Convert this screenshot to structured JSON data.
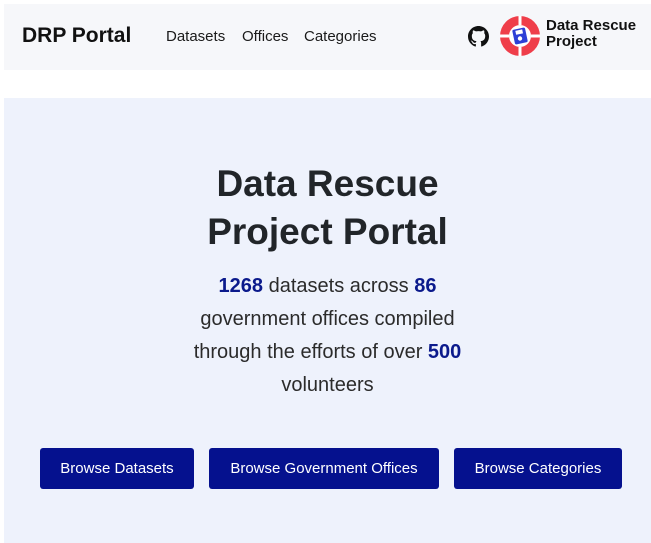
{
  "nav": {
    "brand": "DRP Portal",
    "links": [
      "Datasets",
      "Offices",
      "Categories"
    ],
    "org_name_line1": "Data Rescue",
    "org_name_line2": "Project",
    "github_icon": "github-icon",
    "logo_icon": "data-rescue-project-logo"
  },
  "hero": {
    "title_line1": "Data Rescue",
    "title_line2": "Project Portal",
    "datasets_count": "1268",
    "text_a": " datasets across ",
    "offices_count": "86",
    "text_b": "government offices compiled",
    "text_c": "through the efforts of over ",
    "volunteers_count": "500",
    "text_d": "volunteers",
    "buttons": [
      "Browse Datasets",
      "Browse Government Offices",
      "Browse Categories"
    ]
  },
  "colors": {
    "accent": "#05118e",
    "stat": "#0b1a8c",
    "hero_bg": "#eef2fc",
    "nav_bg": "#f6f7fa"
  }
}
